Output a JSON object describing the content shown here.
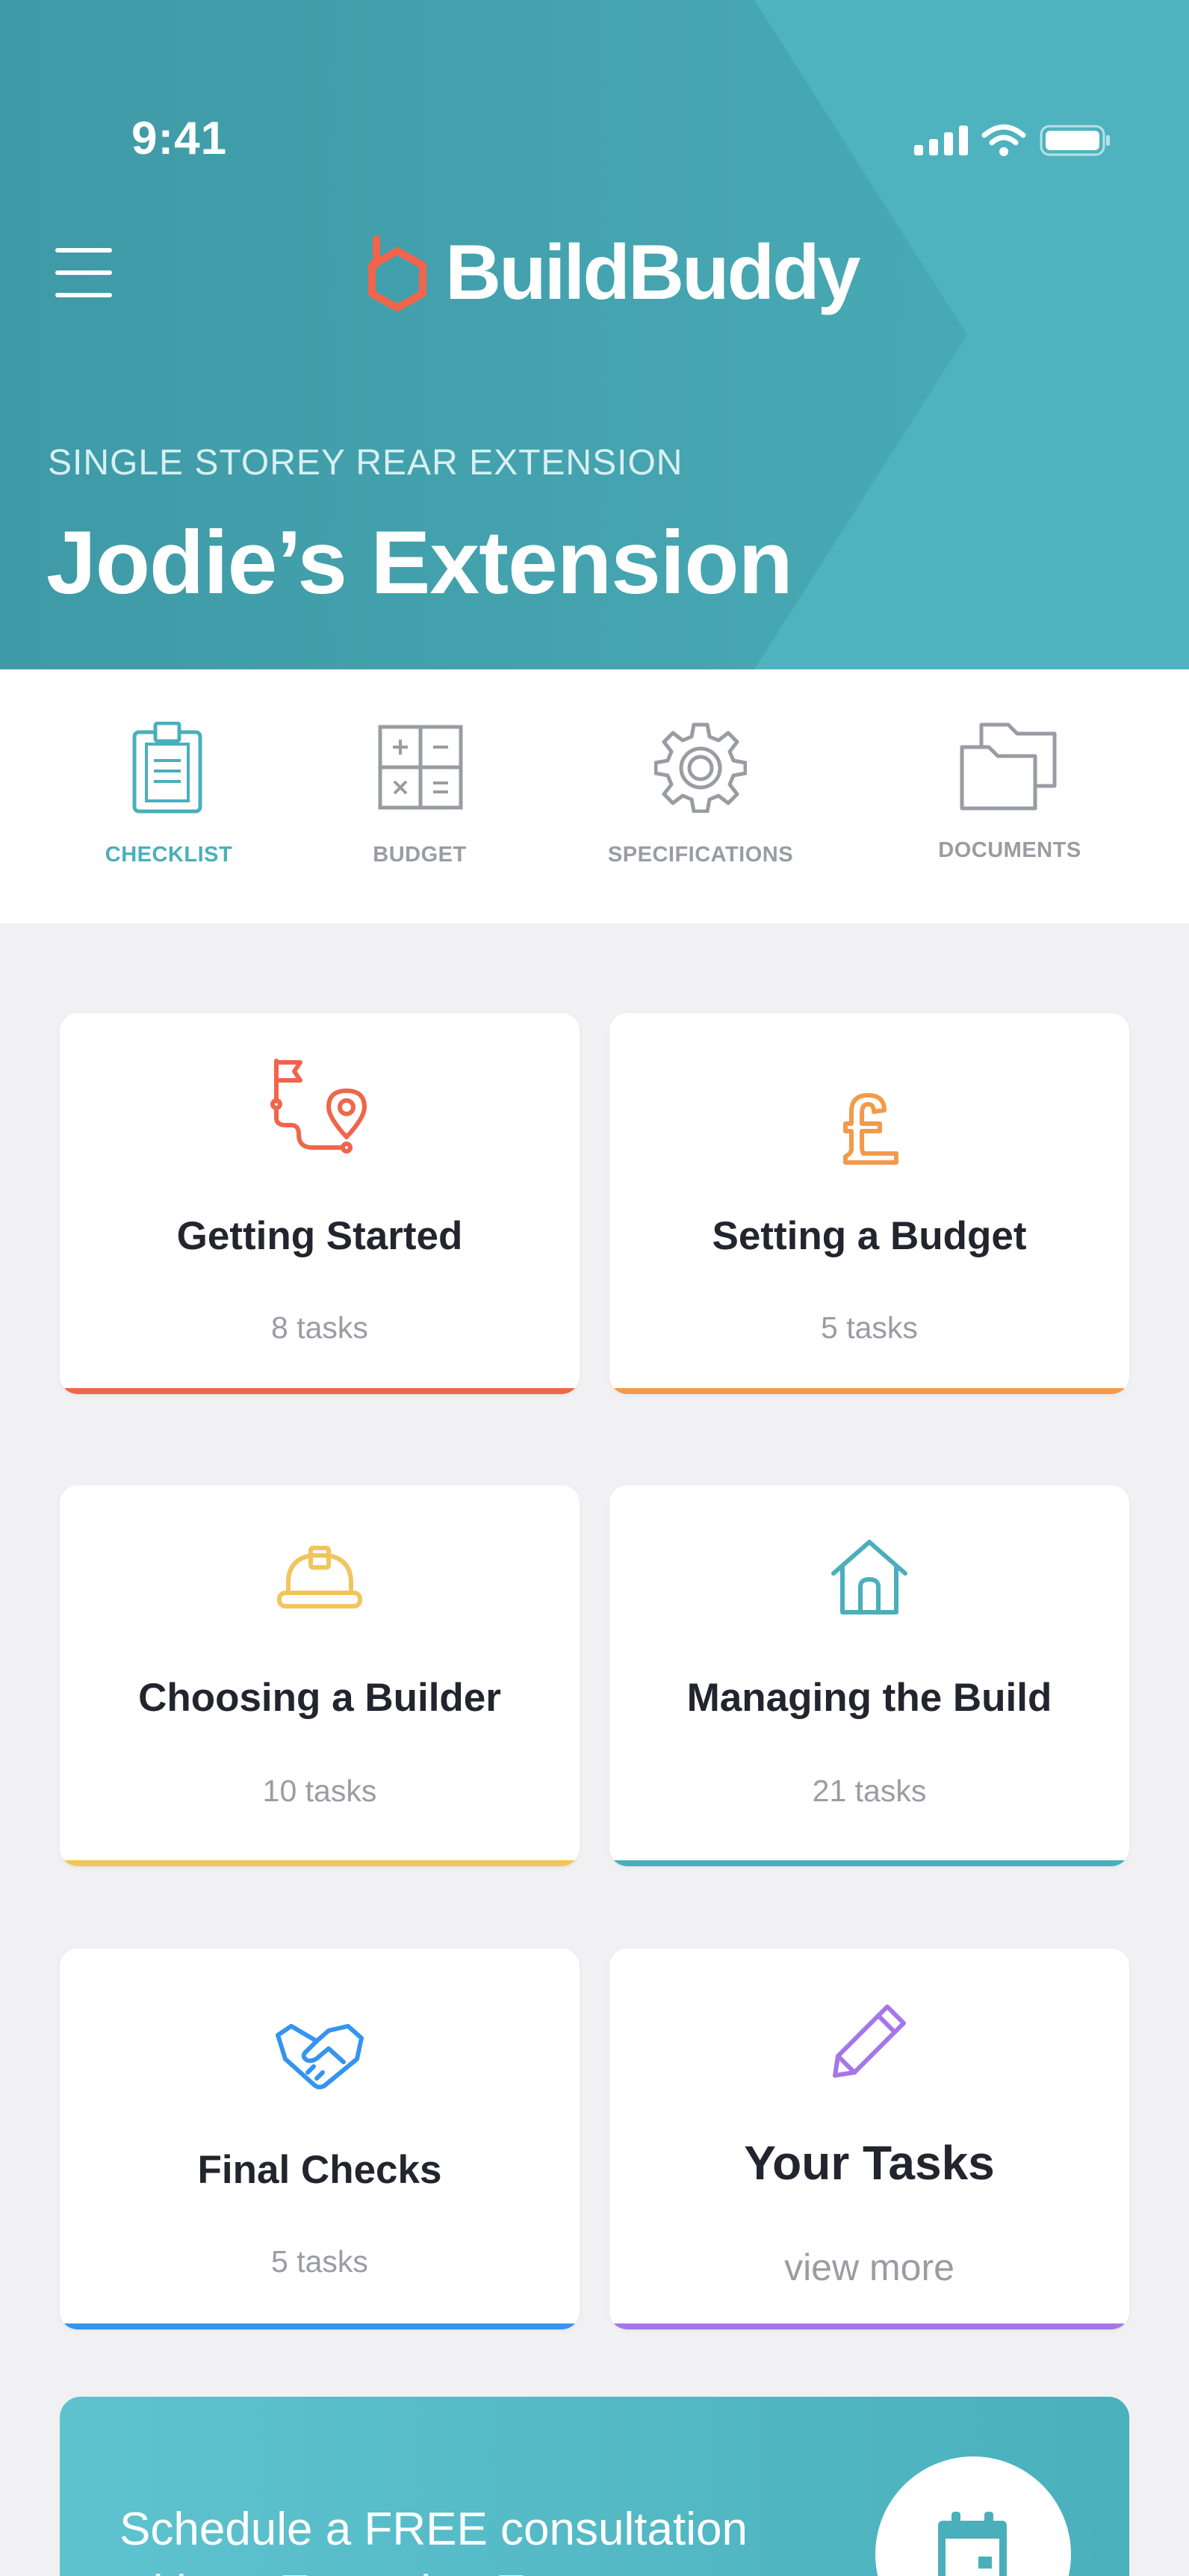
{
  "status_bar": {
    "time": "9:41"
  },
  "header": {
    "brand": "BuildBuddy",
    "project_type": "SINGLE STOREY REAR EXTENSION",
    "project_title": "Jodie’s Extension"
  },
  "tabs": [
    {
      "label": "CHECKLIST",
      "icon": "clipboard-icon",
      "active": true
    },
    {
      "label": "BUDGET",
      "icon": "calculator-icon",
      "active": false
    },
    {
      "label": "SPECIFICATIONS",
      "icon": "gear-icon",
      "active": false
    },
    {
      "label": "DOCUMENTS",
      "icon": "folders-icon",
      "active": false
    }
  ],
  "cards": [
    {
      "title": "Getting Started",
      "subtitle": "8 tasks",
      "icon": "route-flag-pin-icon",
      "color": "#f0654b"
    },
    {
      "title": "Setting a Budget",
      "subtitle": "5 tasks",
      "icon": "pound-sign-icon",
      "color": "#f39a4a"
    },
    {
      "title": "Choosing a Builder",
      "subtitle": "10 tasks",
      "icon": "hard-hat-icon",
      "color": "#f1c55e"
    },
    {
      "title": "Managing the Build",
      "subtitle": "21 tasks",
      "icon": "house-icon",
      "color": "#4aafbb"
    },
    {
      "title": "Final Checks",
      "subtitle": "5 tasks",
      "icon": "handshake-icon",
      "color": "#3594ee"
    },
    {
      "title": "Your Tasks",
      "subtitle": "view more",
      "icon": "pencil-icon",
      "color": "#a477ea"
    }
  ],
  "banner": {
    "text": "Schedule a FREE consultation with an Extension Expert",
    "icon": "calendar-icon"
  }
}
